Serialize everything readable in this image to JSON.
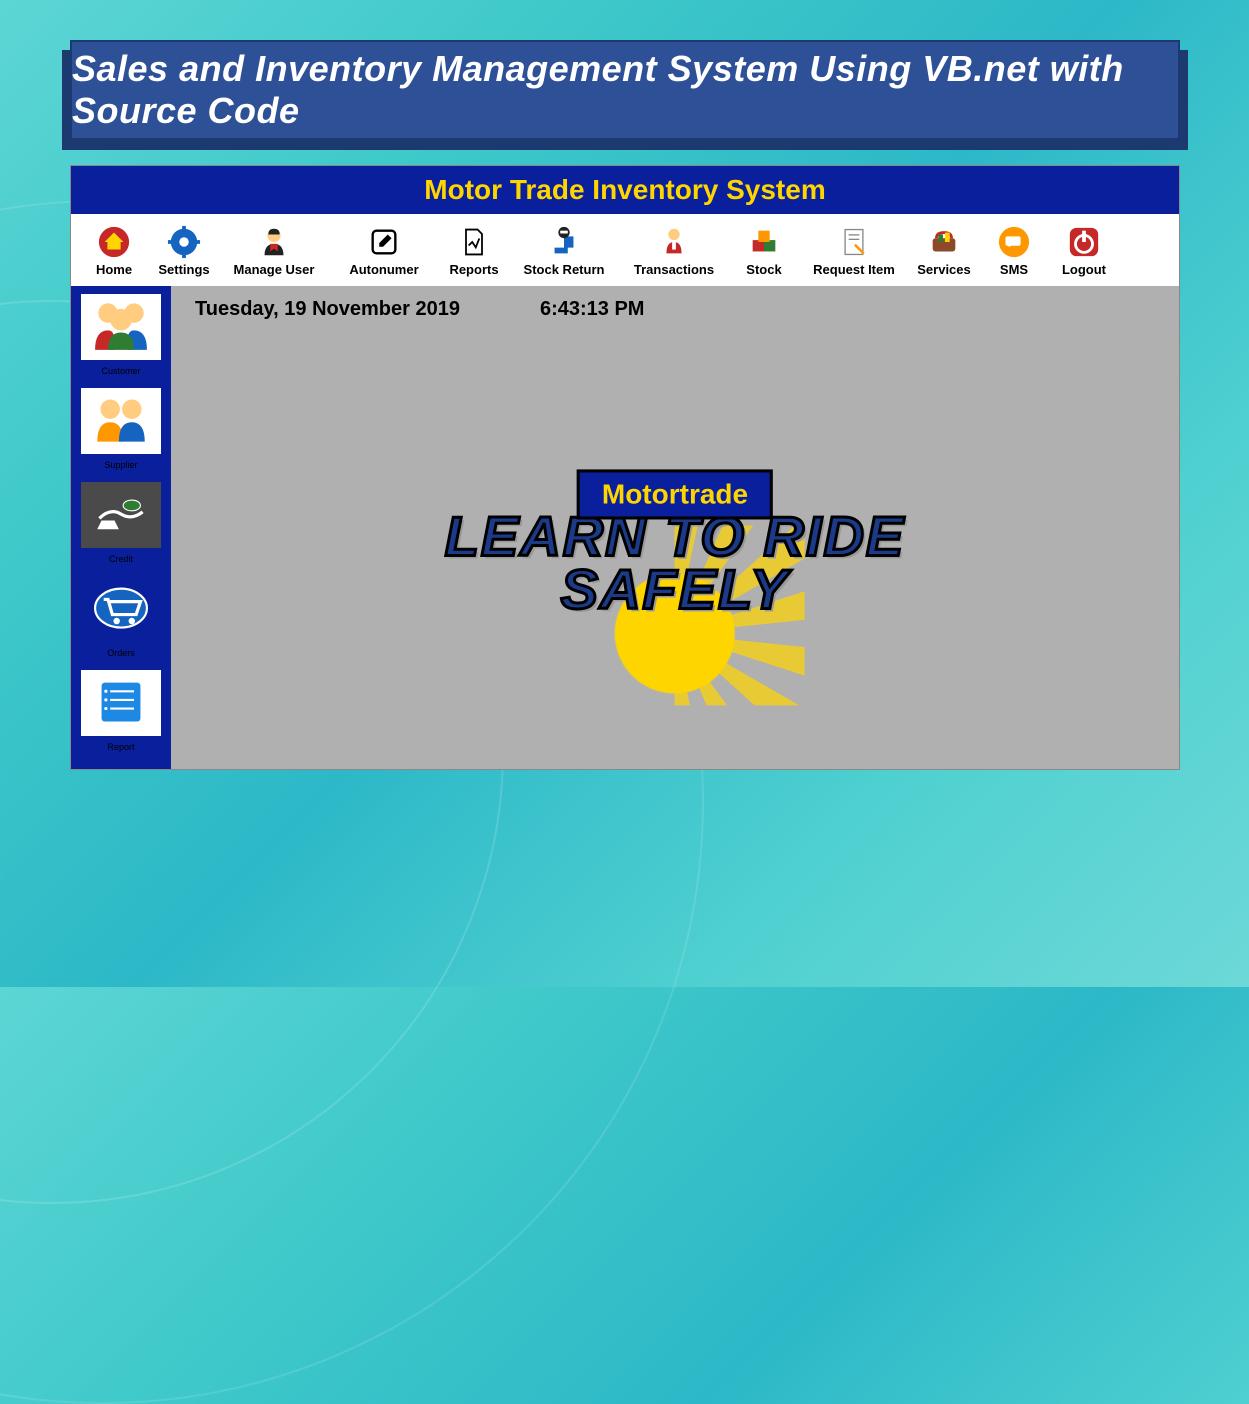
{
  "banner": {
    "text": "Sales and Inventory Management System Using VB.net with Source Code"
  },
  "app": {
    "title": "Motor Trade Inventory System",
    "date": "Tuesday, 19 November 2019",
    "time": "6:43:13 PM"
  },
  "toolbar": [
    {
      "label": "Home",
      "icon": "home-icon"
    },
    {
      "label": "Settings",
      "icon": "gear-icon"
    },
    {
      "label": "Manage User",
      "icon": "user-icon"
    },
    {
      "label": "Autonumer",
      "icon": "edit-icon"
    },
    {
      "label": "Reports",
      "icon": "report-icon"
    },
    {
      "label": "Stock Return",
      "icon": "return-icon"
    },
    {
      "label": "Transactions",
      "icon": "transaction-icon"
    },
    {
      "label": "Stock",
      "icon": "stock-icon"
    },
    {
      "label": "Request Item",
      "icon": "request-icon"
    },
    {
      "label": "Services",
      "icon": "services-icon"
    },
    {
      "label": "SMS",
      "icon": "sms-icon"
    },
    {
      "label": "Logout",
      "icon": "logout-icon"
    }
  ],
  "sidebar": [
    {
      "label": "Customer",
      "icon": "customer-icon"
    },
    {
      "label": "Supplier",
      "icon": "supplier-icon"
    },
    {
      "label": "Credit",
      "icon": "credit-icon"
    },
    {
      "label": "Orders",
      "icon": "cart-icon"
    },
    {
      "label": "Report",
      "icon": "list-icon"
    }
  ],
  "logo": {
    "brand": "Motortrade",
    "line1": "LEARN TO RIDE",
    "line2": "SAFELY"
  },
  "colors": {
    "primary_blue": "#0a1f9c",
    "accent_yellow": "#ffd500",
    "banner_blue": "#2d5096",
    "gray_bg": "#b0b0b0"
  }
}
